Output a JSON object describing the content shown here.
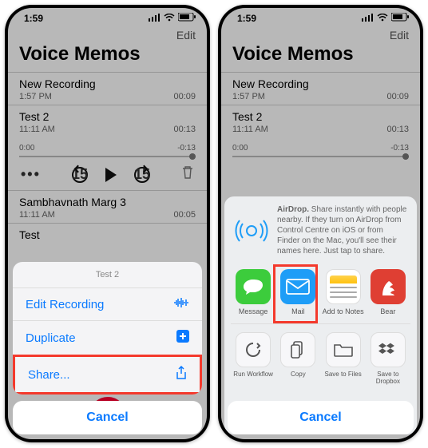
{
  "status": {
    "time": "1:59",
    "signal": "signal",
    "wifi": "wifi",
    "battery": "battery"
  },
  "header": {
    "edit": "Edit",
    "title": "Voice Memos"
  },
  "memos": [
    {
      "name": "New Recording",
      "time": "1:57 PM",
      "dur": "00:09"
    },
    {
      "name": "Test 2",
      "time": "11:11 AM",
      "dur": "00:13"
    }
  ],
  "expanded": {
    "left": "0:00",
    "right": "-0:13",
    "skip": "15"
  },
  "extra": [
    {
      "name": "Sambhavnath Marg 3",
      "time": "11:11 AM",
      "dur": "00:05"
    },
    {
      "name": "Test"
    }
  ],
  "actionsheet": {
    "title": "Test 2",
    "edit": "Edit Recording",
    "duplicate": "Duplicate",
    "share": "Share...",
    "cancel": "Cancel"
  },
  "sharesheet": {
    "airdrop_title": "AirDrop.",
    "airdrop_body": "Share instantly with people nearby. If they turn on AirDrop from Control Centre on iOS or from Finder on the Mac, you'll see their names here. Just tap to share.",
    "apps": {
      "message": "Message",
      "mail": "Mail",
      "notes": "Add to Notes",
      "bear": "Bear"
    },
    "actions": {
      "workflow": "Run Workflow",
      "copy": "Copy",
      "files": "Save to Files",
      "dropbox": "Save to Dropbox"
    },
    "cancel": "Cancel"
  }
}
